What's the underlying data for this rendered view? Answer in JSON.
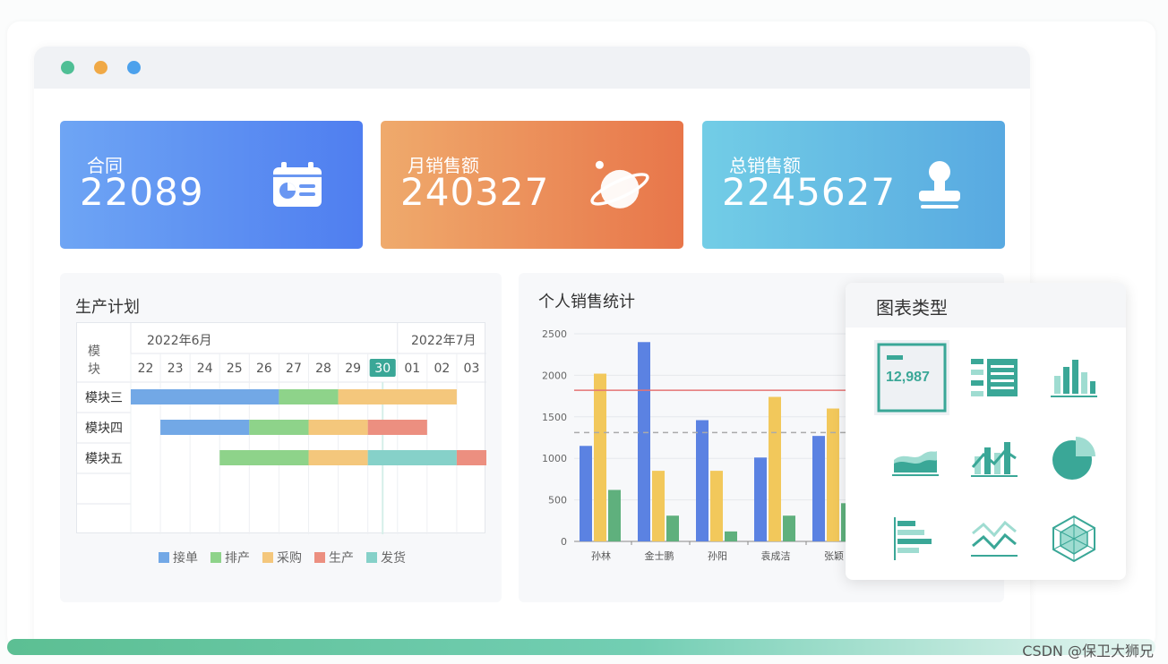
{
  "window": {
    "traffic_lights": [
      "#4fbf95",
      "#f0a946",
      "#4ca1ec"
    ]
  },
  "kpis": [
    {
      "label": "合同",
      "value": "22089",
      "icon": "contract-card-icon",
      "gradient": [
        "#6ea5f4",
        "#4f7ef0"
      ]
    },
    {
      "label": "月销售额",
      "value": "240327",
      "icon": "planet-icon",
      "gradient": [
        "#efaa6c",
        "#e8764a"
      ]
    },
    {
      "label": "总销售额",
      "value": "2245627",
      "icon": "stamp-icon",
      "gradient": [
        "#72cde6",
        "#58a9e1"
      ]
    }
  ],
  "gantt": {
    "title": "生产计划",
    "module_header": "模块",
    "months": [
      "2022年6月",
      "2022年7月"
    ],
    "days": [
      "22",
      "23",
      "24",
      "25",
      "26",
      "27",
      "28",
      "29",
      "30",
      "01",
      "02",
      "03"
    ],
    "today": "30",
    "rows": [
      "模块三",
      "模块四",
      "模块五"
    ],
    "legend": [
      {
        "name": "接单",
        "color": "#72a8e6"
      },
      {
        "name": "排产",
        "color": "#8ed38a"
      },
      {
        "name": "采购",
        "color": "#f4c77c"
      },
      {
        "name": "生产",
        "color": "#ec8f80"
      },
      {
        "name": "发货",
        "color": "#86d1c9"
      }
    ],
    "tasks": [
      {
        "row": 0,
        "type": 0,
        "start": 0,
        "end": 5
      },
      {
        "row": 0,
        "type": 1,
        "start": 5,
        "end": 7
      },
      {
        "row": 0,
        "type": 2,
        "start": 7,
        "end": 11
      },
      {
        "row": 1,
        "type": 0,
        "start": 1,
        "end": 4
      },
      {
        "row": 1,
        "type": 1,
        "start": 4,
        "end": 6
      },
      {
        "row": 1,
        "type": 2,
        "start": 6,
        "end": 8
      },
      {
        "row": 1,
        "type": 3,
        "start": 8,
        "end": 10
      },
      {
        "row": 2,
        "type": 1,
        "start": 3,
        "end": 6
      },
      {
        "row": 2,
        "type": 2,
        "start": 6,
        "end": 8
      },
      {
        "row": 2,
        "type": 4,
        "start": 8,
        "end": 11
      },
      {
        "row": 2,
        "type": 3,
        "start": 11,
        "end": 12
      }
    ]
  },
  "chart_data": {
    "type": "bar",
    "title": "个人销售统计",
    "categories": [
      "孙林",
      "金士鹏",
      "孙阳",
      "袁成洁",
      "张颖"
    ],
    "series": [
      {
        "color": "#5b82e2",
        "values": [
          1150,
          2400,
          1460,
          1010,
          1270
        ]
      },
      {
        "color": "#f2c85b",
        "values": [
          2020,
          850,
          850,
          1740,
          1600
        ]
      },
      {
        "color": "#5fb07d",
        "values": [
          620,
          310,
          120,
          310,
          460
        ]
      }
    ],
    "ylim": [
      0,
      2500
    ],
    "yticks": [
      "0",
      "500",
      "1000",
      "1500",
      "2000",
      "2500"
    ],
    "reference_lines": [
      {
        "value": 1820,
        "style": "solid",
        "color": "#e57373"
      },
      {
        "value": 1310,
        "style": "dashed",
        "color": "#aaaaaa"
      }
    ]
  },
  "chart_types": {
    "title": "图表类型",
    "sample_value": "12,987",
    "items": [
      {
        "name": "kpi-card-chart-icon",
        "selected": true
      },
      {
        "name": "table-chart-icon"
      },
      {
        "name": "column-chart-icon"
      },
      {
        "name": "area-chart-icon"
      },
      {
        "name": "combo-chart-icon"
      },
      {
        "name": "pie-chart-icon"
      },
      {
        "name": "horizontal-bar-chart-icon"
      },
      {
        "name": "line-chart-icon"
      },
      {
        "name": "radar-chart-icon"
      }
    ]
  },
  "watermark": "CSDN @保卫大狮兄"
}
